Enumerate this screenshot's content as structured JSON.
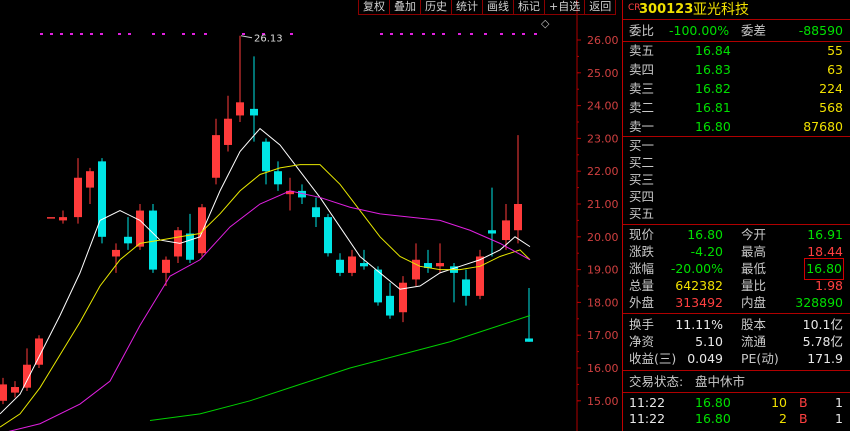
{
  "toolbar": {
    "buttons": [
      "复权",
      "叠加",
      "历史",
      "统计",
      "画线",
      "标记",
      "+自选",
      "返回"
    ]
  },
  "chart": {
    "max_label": "26.13",
    "y_ticks": [
      "26.00",
      "25.00",
      "24.00",
      "23.00",
      "22.00",
      "21.00",
      "20.00",
      "19.00",
      "18.00",
      "17.00",
      "16.00",
      "15.00"
    ]
  },
  "colors": {
    "up": "#ff3b3b",
    "down": "#00e5e5",
    "ma5": "#ffffff",
    "ma10": "#e8e800",
    "ma20": "#e020e0",
    "ma60": "#00d000",
    "axis": "#b00000"
  },
  "quote": {
    "cr": "CR",
    "code": "300123",
    "name": "亚光科技",
    "weibi_label": "委比",
    "weibi": "-100.00%",
    "weicha_label": "委差",
    "weicha": "-88590",
    "sells": [
      {
        "label": "卖五",
        "price": "16.84",
        "vol": "55"
      },
      {
        "label": "卖四",
        "price": "16.83",
        "vol": "63"
      },
      {
        "label": "卖三",
        "price": "16.82",
        "vol": "224"
      },
      {
        "label": "卖二",
        "price": "16.81",
        "vol": "568"
      },
      {
        "label": "卖一",
        "price": "16.80",
        "vol": "87680"
      }
    ],
    "buys": [
      {
        "label": "买一"
      },
      {
        "label": "买二"
      },
      {
        "label": "买三"
      },
      {
        "label": "买四"
      },
      {
        "label": "买五"
      }
    ],
    "stats": [
      {
        "l1": "现价",
        "v1": "16.80",
        "l2": "今开",
        "v2": "16.91"
      },
      {
        "l1": "涨跌",
        "v1": "-4.20",
        "l2": "最高",
        "v2": "18.44"
      },
      {
        "l1": "涨幅",
        "v1": "-20.00%",
        "l2": "最低",
        "v2": "16.80"
      },
      {
        "l1": "总量",
        "v1": "642382",
        "l2": "量比",
        "v2": "1.98"
      },
      {
        "l1": "外盘",
        "v1": "313492",
        "l2": "内盘",
        "v2": "328890"
      }
    ],
    "fundamentals": [
      {
        "l1": "换手",
        "v1": "11.11%",
        "l2": "股本",
        "v2": "10.1亿"
      },
      {
        "l1": "净资",
        "v1": "5.10",
        "l2": "流通",
        "v2": "5.78亿"
      },
      {
        "l1": "收益(三)",
        "v1": "0.049",
        "l2": "PE(动)",
        "v2": "171.9"
      }
    ],
    "status_label": "交易状态:",
    "status": "盘中休市",
    "ticks": [
      {
        "time": "11:22",
        "price": "16.80",
        "vol": "10",
        "side": "B",
        "n": "1"
      },
      {
        "time": "11:22",
        "price": "16.80",
        "vol": "2",
        "side": "B",
        "n": "1"
      }
    ]
  }
}
